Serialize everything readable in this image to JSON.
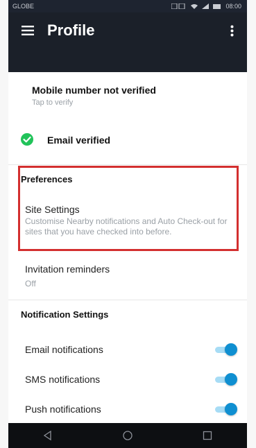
{
  "status_bar": {
    "carrier": "GLOBE",
    "time": "08:00"
  },
  "app_bar": {
    "title": "Profile",
    "menu_icon": "hamburger-menu-icon",
    "more_icon": "more-vertical-icon"
  },
  "verification": {
    "mobile_title": "Mobile number not verified",
    "mobile_sub": "Tap to verify",
    "email_title": "Email verified",
    "email_icon": "check-circle-icon",
    "email_icon_color": "#21c35a"
  },
  "preferences": {
    "section_title": "Preferences",
    "site_settings_title": "Site Settings",
    "site_settings_desc": "Customise Nearby notifications and Auto Check-out for sites that you have checked into before."
  },
  "invitation": {
    "title": "Invitation reminders",
    "value": "Off"
  },
  "notification_settings": {
    "section_title": "Notification Settings",
    "items": [
      {
        "label": "Email notifications",
        "enabled": true
      },
      {
        "label": "SMS notifications",
        "enabled": true
      },
      {
        "label": "Push notifications",
        "enabled": true
      }
    ]
  },
  "colors": {
    "app_bar": "#1b2029",
    "toggle_on": "#0f8fd1",
    "highlight": "#d32f2f"
  },
  "nav_icons": [
    "back-icon",
    "home-icon",
    "recents-icon"
  ]
}
